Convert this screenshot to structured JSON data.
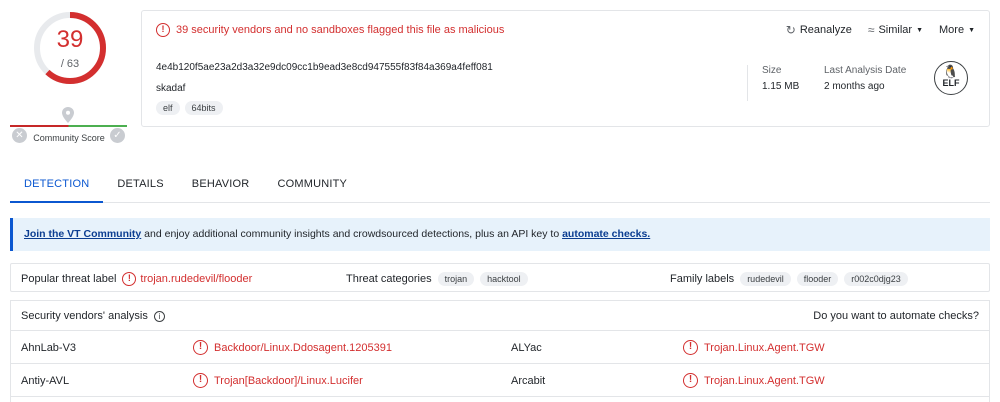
{
  "score": {
    "detected": "39",
    "total": "/ 63",
    "detected_fraction": 0.619,
    "community_label": "Community Score",
    "colors": {
      "danger": "#d32f2f",
      "safe": "#4caf50",
      "track": "#e8eaed"
    }
  },
  "header": {
    "flag_message": "39 security vendors and no sandboxes flagged this file as malicious",
    "actions": [
      {
        "label": "Reanalyze",
        "icon": "refresh-icon"
      },
      {
        "label": "Similar",
        "icon": "similar-icon"
      },
      {
        "label": "More",
        "icon": "chevron-down-icon"
      }
    ],
    "hash": "4e4b120f5ae23a2d3a32e9dc09cc1b9ead3e8cd947555f83f84a369a4feff081",
    "filename": "skadaf",
    "tags": [
      "elf",
      "64bits"
    ],
    "size_label": "Size",
    "size_value": "1.15 MB",
    "last_analysis_label": "Last Analysis Date",
    "last_analysis_value": "2 months ago",
    "filetype_badge": "ELF"
  },
  "tabs": [
    "DETECTION",
    "DETAILS",
    "BEHAVIOR",
    "COMMUNITY"
  ],
  "banner": {
    "link1": "Join the VT Community",
    "middle": " and enjoy additional community insights and crowdsourced detections, plus an API key to ",
    "link2": "automate checks."
  },
  "threat": {
    "popular_label": "Popular threat label",
    "popular_value": "trojan.rudedevil/flooder",
    "categories_label": "Threat categories",
    "categories": [
      "trojan",
      "hacktool"
    ],
    "family_label": "Family labels",
    "families": [
      "rudedevil",
      "flooder",
      "r002c0djg23"
    ]
  },
  "vendors": {
    "title": "Security vendors' analysis",
    "automate": "Do you want to automate checks?",
    "rows": [
      {
        "vendor1": "AhnLab-V3",
        "result1": "Backdoor/Linux.Ddosagent.1205391",
        "vendor2": "ALYac",
        "result2": "Trojan.Linux.Agent.TGW"
      },
      {
        "vendor1": "Antiy-AVL",
        "result1": "Trojan[Backdoor]/Linux.Lucifer",
        "vendor2": "Arcabit",
        "result2": "Trojan.Linux.Agent.TGW"
      }
    ]
  }
}
